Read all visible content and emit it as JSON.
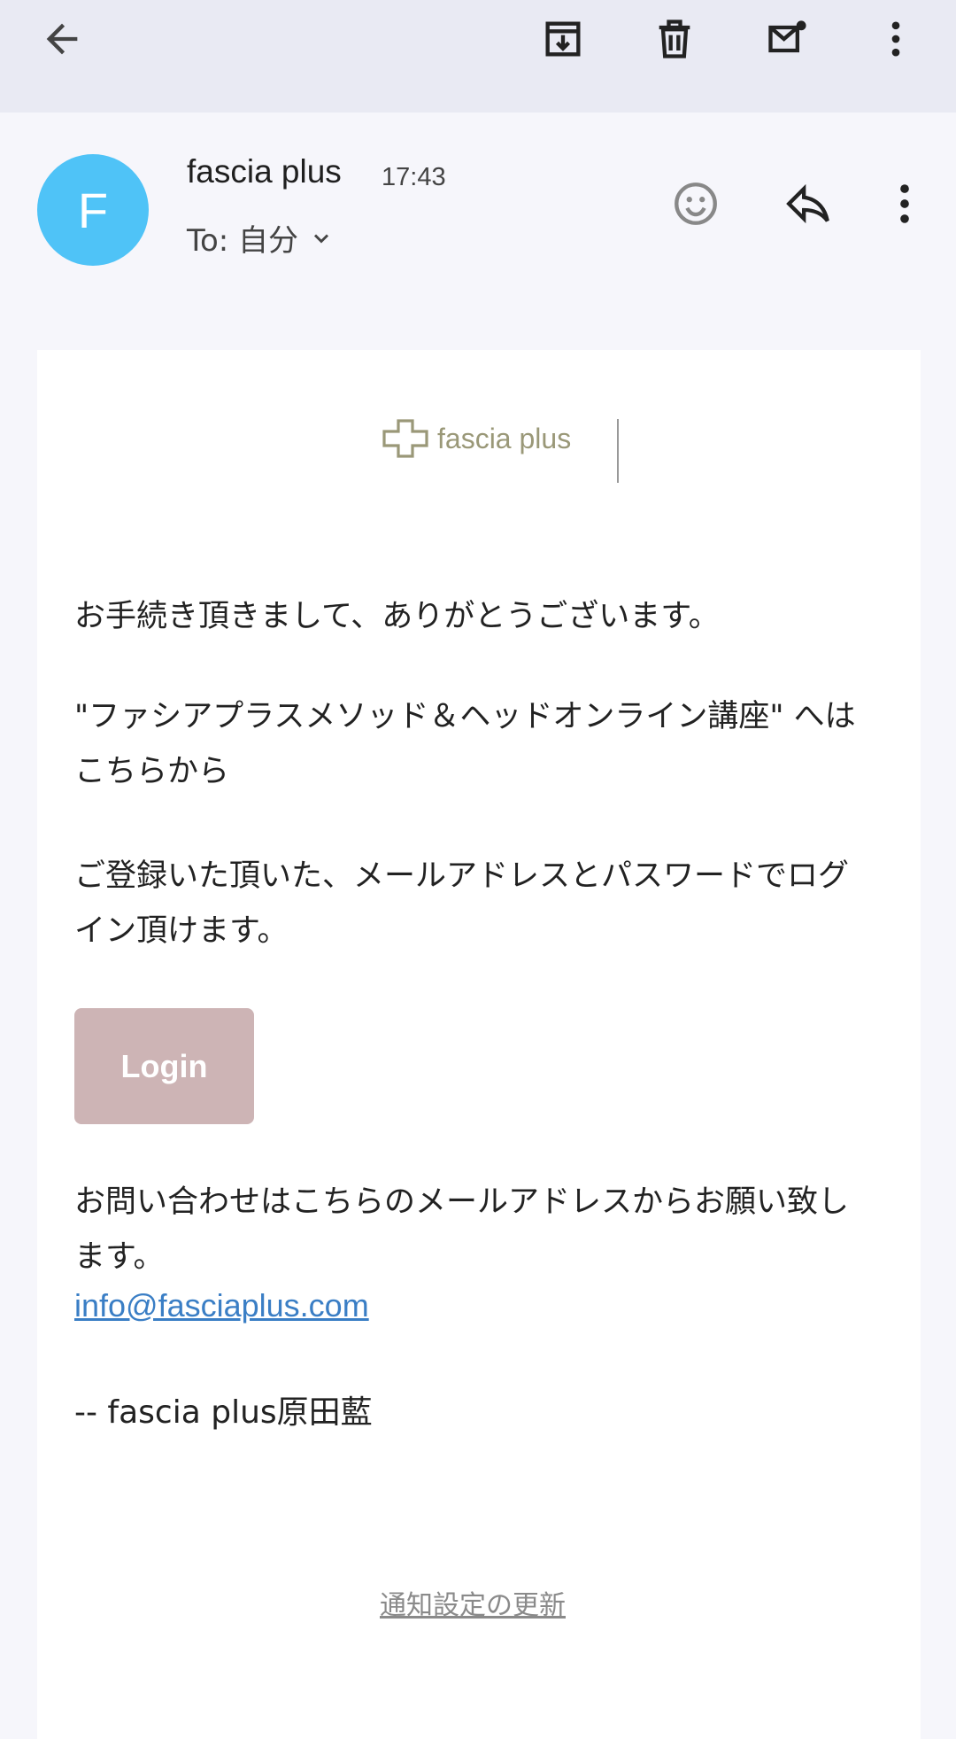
{
  "toolbar": {
    "back_icon": "arrow-left-icon",
    "archive_icon": "archive-icon",
    "delete_icon": "trash-icon",
    "mark_unread_icon": "mail-unread-icon",
    "more_icon": "more-vert-icon"
  },
  "header": {
    "avatar_letter": "F",
    "avatar_color": "#4fc3f7",
    "sender": "fascia plus",
    "time": "17:43",
    "to_label": "To: 自分",
    "emoji_icon": "emoji-react-icon",
    "reply_icon": "reply-icon",
    "more_icon": "more-vert-icon"
  },
  "email": {
    "logo_text": "fascia plus",
    "paragraph1": "お手続き頂きまして、ありがとうございます。",
    "paragraph2": "\"ファシアプラスメソッド＆ヘッドオンライン講座\" へはこちらから",
    "paragraph3": "ご登録いた頂いた、メールアドレスとパスワードでログイン頂けます。",
    "login_button": "Login",
    "login_color": "#cdb4b5",
    "contact_text": "お問い合わせはこちらのメールアドレスからお願い致します。",
    "contact_email": "info@fasciaplus.com",
    "signature": "-- fascia plus原田藍",
    "notification_link": "通知設定の更新"
  }
}
